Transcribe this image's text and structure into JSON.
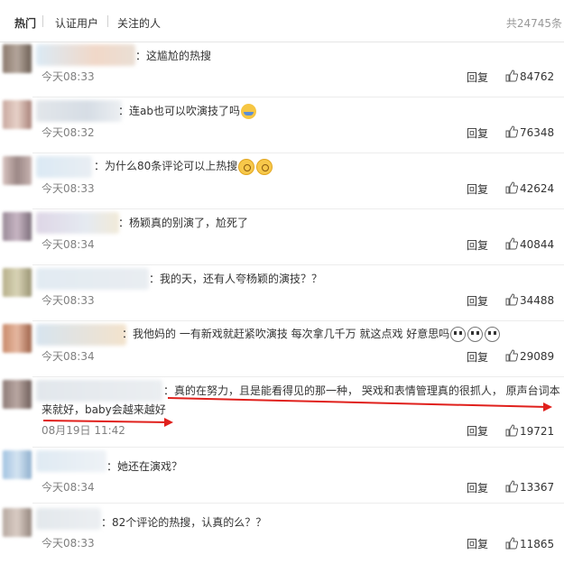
{
  "tabs": {
    "hot": "热门",
    "verified": "认证用户",
    "following": "关注的人",
    "total": "共24745条"
  },
  "reply_label": "回复",
  "comments": [
    {
      "text": "：这尴尬的热搜",
      "time": "今天08:33",
      "likes": "84762"
    },
    {
      "text": "：连ab也可以吹演技了吗",
      "time": "今天08:32",
      "likes": "76348",
      "emoji": "laugh-emoji"
    },
    {
      "text": "：为什么80条评论可以上热搜",
      "time": "今天08:33",
      "likes": "42624",
      "emoji": "thinking-emoji"
    },
    {
      "text": "：杨颖真的别演了，尬死了",
      "time": "今天08:34",
      "likes": "40844"
    },
    {
      "text": "：我的天，还有人夸杨颖的演技？？",
      "time": "今天08:33",
      "likes": "34488"
    },
    {
      "text": "：我他妈的 一有新戏就赶紧吹演技 每次拿几千万 就这点戏 好意思吗",
      "time": "今天08:34",
      "likes": "29089",
      "emoji": "skull-emoji"
    },
    {
      "text": "：真的在努力，且是能看得见的那一种， 哭戏和表情管理真的很抓人， 原声台词本",
      "text2": "来就好，baby会越来越好",
      "time": "08月19日 11:42",
      "likes": "19721"
    },
    {
      "text": "：她还在演戏？",
      "time": "今天08:34",
      "likes": "13367"
    },
    {
      "text": "：82个评论的热搜，认真的么？？",
      "time": "今天08:33",
      "likes": "11865"
    }
  ],
  "colors": {
    "annotation_red": "#e0201c",
    "time_gray": "#808080"
  }
}
